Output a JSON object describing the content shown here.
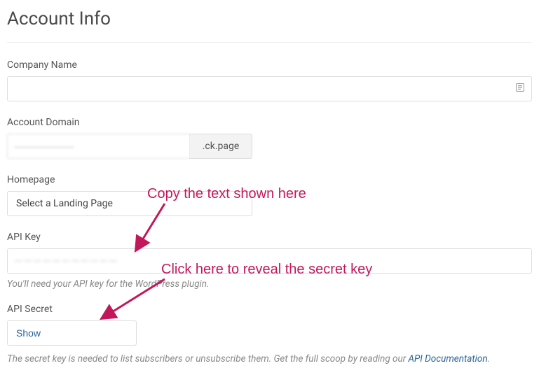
{
  "page": {
    "title": "Account Info"
  },
  "fields": {
    "company": {
      "label": "Company Name",
      "value": ""
    },
    "domain": {
      "label": "Account Domain",
      "value": "——————",
      "suffix": ".ck.page"
    },
    "homepage": {
      "label": "Homepage",
      "placeholder": "Select a Landing Page"
    },
    "apiKey": {
      "label": "API Key",
      "value": "———————————",
      "help": "You'll need your API key for the WordPress plugin."
    },
    "apiSecret": {
      "label": "API Secret",
      "button": "Show",
      "help_pre": "The secret key is needed to list subscribers or unsubscribe them. Get the full scoop by reading our ",
      "help_link": "API Documentation",
      "help_post": "."
    }
  },
  "annotations": {
    "copy": "Copy the text shown here",
    "click": "Click here to reveal the secret key"
  }
}
